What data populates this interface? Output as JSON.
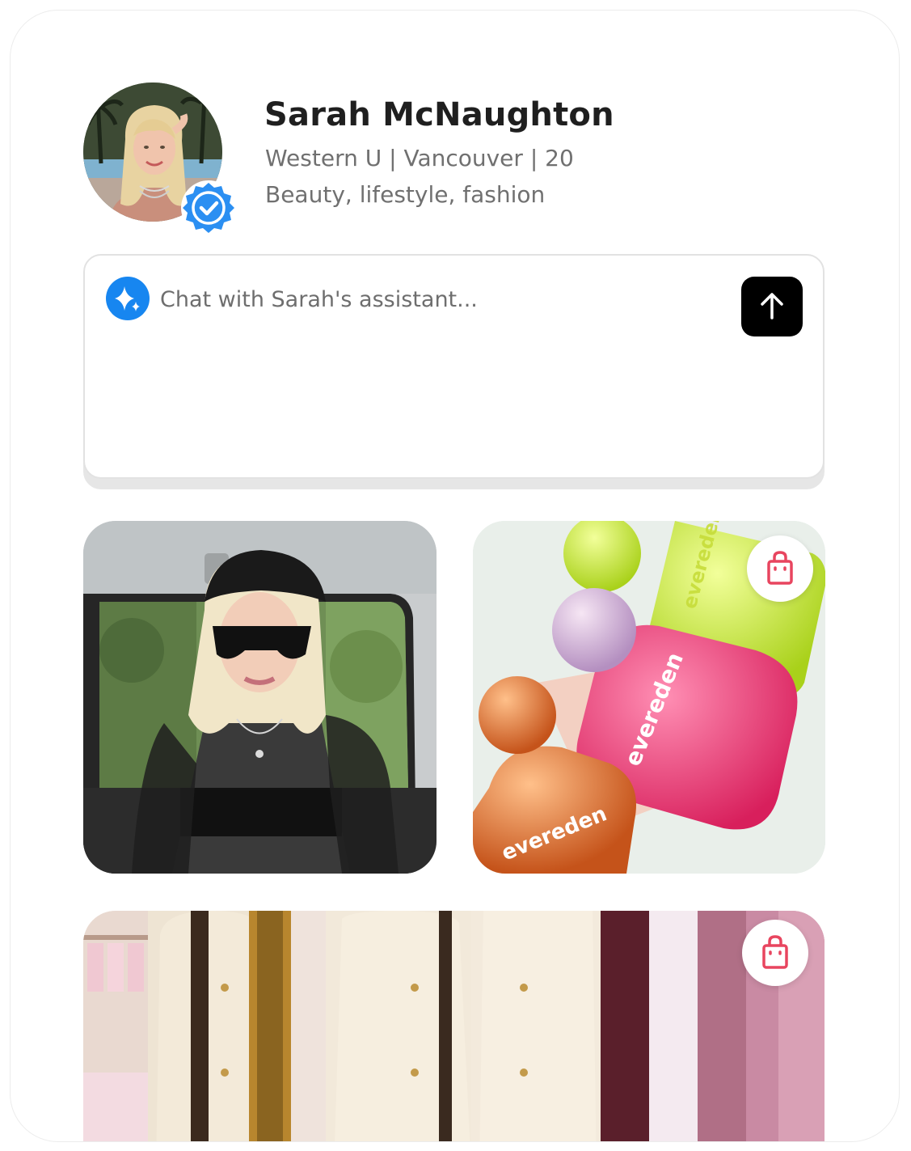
{
  "profile": {
    "name": "Sarah McNaughton",
    "details": "Western U | Vancouver | 20",
    "interests": "Beauty, lifestyle, fashion",
    "verified": true
  },
  "chat": {
    "placeholder": "Chat with Sarah's assistant...",
    "assistant_icon": "sparkle-icon",
    "send_icon": "arrow-up-icon"
  },
  "media": [
    {
      "kind": "photo",
      "shoppable": false
    },
    {
      "kind": "product-photo",
      "shoppable": true,
      "shop_icon": "shopping-bag-icon"
    },
    {
      "kind": "product-photo",
      "shoppable": true,
      "shop_icon": "shopping-bag-icon"
    }
  ],
  "colors": {
    "verified_badge": "#2b8ff2",
    "assistant_icon_bg": "#1786f0",
    "send_button": "#000000",
    "shop_icon": "#e8455f"
  }
}
